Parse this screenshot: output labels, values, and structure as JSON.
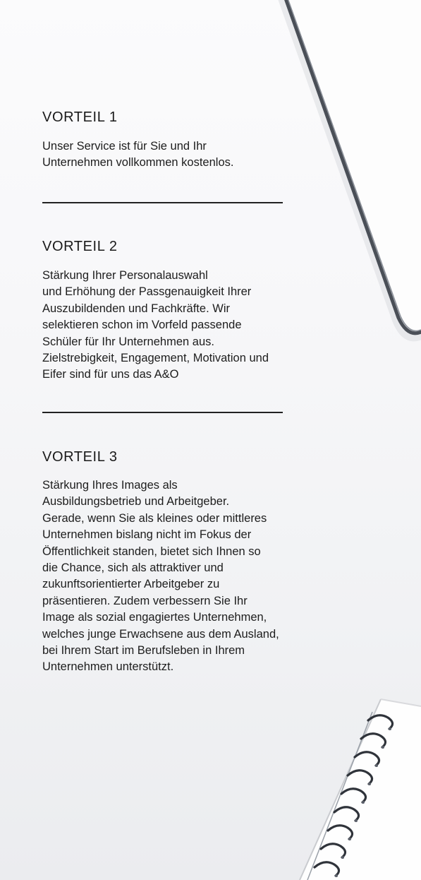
{
  "advantages": [
    {
      "heading": "VORTEIL 1",
      "text": "Unser Service ist für Sie und Ihr\nUnternehmen vollkommen kostenlos."
    },
    {
      "heading": "VORTEIL 2",
      "text": "Stärkung Ihrer Personalauswahl\nund Erhöhung der Passgenauigkeit Ihrer\nAuszubildenden und Fachkräfte. Wir\nselektieren schon im Vorfeld passende\nSchüler für Ihr Unternehmen aus.\nZielstrebigkeit, Engagement, Motivation und\nEifer sind für uns das A&O"
    },
    {
      "heading": "VORTEIL 3",
      "text": "Stärkung Ihres Images als\nAusbildungsbetrieb und Arbeitgeber.\nGerade, wenn Sie als kleines oder mittleres\nUnternehmen bislang nicht im Fokus der\nÖffentlichkeit standen, bietet sich Ihnen so\ndie Chance, sich als attraktiver und\nzukunftsorientierter Arbeitgeber zu\npräsentieren. Zudem verbessern Sie Ihr\nImage als sozial engagiertes Unternehmen,\nwelches junge Erwachsene aus dem Ausland,\nbei Ihrem Start im Berufsleben in Ihrem\nUnternehmen unterstützt."
    }
  ],
  "colors": {
    "text": "#1d1d1d",
    "divider": "#222222",
    "tablet_frame": "#4a4f57"
  },
  "decor": {
    "top_right": "tablet-corner",
    "bottom_right": "spiral-notebook"
  }
}
